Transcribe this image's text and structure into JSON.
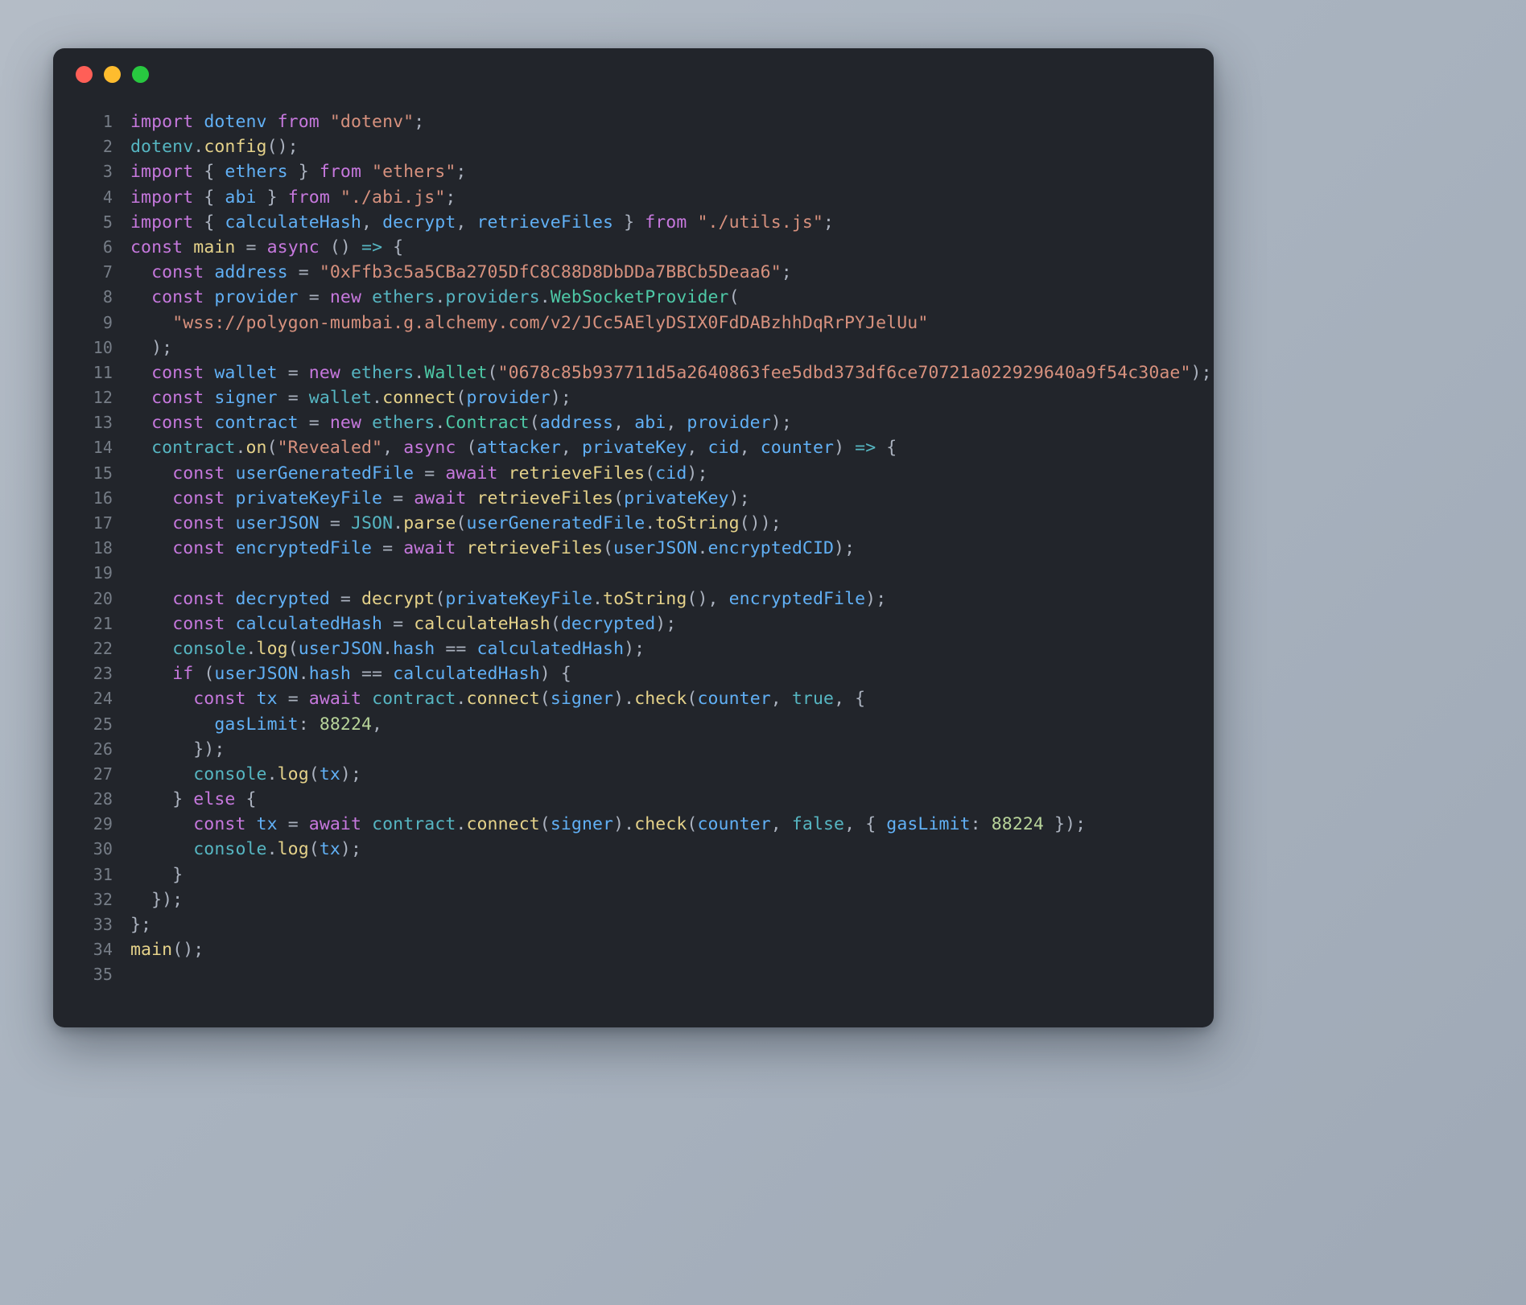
{
  "window": {
    "name": "code-editor-window",
    "background_color": "#22252b",
    "page_background": "#aab3bf",
    "traffic_lights": [
      {
        "name": "close-button",
        "color": "#ff5f57",
        "label": "Close"
      },
      {
        "name": "minimize-button",
        "color": "#febc2e",
        "label": "Minimize"
      },
      {
        "name": "maximize-button",
        "color": "#28c840",
        "label": "Maximize"
      }
    ]
  },
  "theme": {
    "keyword": "#c678dd",
    "variable": "#61b0f5",
    "class": "#56b6c2",
    "type": "#4ec9a7",
    "string": "#d7917e",
    "function": "#e5d28a",
    "number": "#b8d49a",
    "punctuation": "#abb2bf",
    "line_number": "#767d87"
  },
  "editor": {
    "language": "javascript",
    "total_lines": 35,
    "line_numbers": [
      1,
      2,
      3,
      4,
      5,
      6,
      7,
      8,
      9,
      10,
      11,
      12,
      13,
      14,
      15,
      16,
      17,
      18,
      19,
      20,
      21,
      22,
      23,
      24,
      25,
      26,
      27,
      28,
      29,
      30,
      31,
      32,
      33,
      34,
      35
    ],
    "lines": [
      "import dotenv from \"dotenv\";",
      "dotenv.config();",
      "import { ethers } from \"ethers\";",
      "import { abi } from \"./abi.js\";",
      "import { calculateHash, decrypt, retrieveFiles } from \"./utils.js\";",
      "const main = async () => {",
      "  const address = \"0xFfb3c5a5CBa2705DfC8C88D8DbDDa7BBCb5Deaa6\";",
      "  const provider = new ethers.providers.WebSocketProvider(",
      "    \"wss://polygon-mumbai.g.alchemy.com/v2/JCc5AElyDSIX0FdDABzhhDqRrPYJelUu\"",
      "  );",
      "  const wallet = new ethers.Wallet(\"0678c85b937711d5a2640863fee5dbd373df6ce70721a022929640a9f54c30ae\");",
      "  const signer = wallet.connect(provider);",
      "  const contract = new ethers.Contract(address, abi, provider);",
      "  contract.on(\"Revealed\", async (attacker, privateKey, cid, counter) => {",
      "    const userGeneratedFile = await retrieveFiles(cid);",
      "    const privateKeyFile = await retrieveFiles(privateKey);",
      "    const userJSON = JSON.parse(userGeneratedFile.toString());",
      "    const encryptedFile = await retrieveFiles(userJSON.encryptedCID);",
      "",
      "    const decrypted = decrypt(privateKeyFile.toString(), encryptedFile);",
      "    const calculatedHash = calculateHash(decrypted);",
      "    console.log(userJSON.hash == calculatedHash);",
      "    if (userJSON.hash == calculatedHash) {",
      "      const tx = await contract.connect(signer).check(counter, true, {",
      "        gasLimit: 88224,",
      "      });",
      "      console.log(tx);",
      "    } else {",
      "      const tx = await contract.connect(signer).check(counter, false, { gasLimit: 88224 });",
      "      console.log(tx);",
      "    }",
      "  });",
      "};",
      "main();",
      ""
    ],
    "values": {
      "contract_address": "0xFfb3c5a5CBa2705DfC8C88D8DbDDa7BBCb5Deaa6",
      "rpc_url": "wss://polygon-mumbai.g.alchemy.com/v2/JCc5AElyDSIX0FdDABzhhDqRrPYJelUu",
      "private_key": "0678c85b937711d5a2640863fee5dbd373df6ce70721a022929640a9f54c30ae",
      "event_name": "Revealed",
      "gas_limit": "88224",
      "imports": [
        "dotenv",
        "ethers",
        "./abi.js",
        "./utils.js"
      ]
    }
  }
}
